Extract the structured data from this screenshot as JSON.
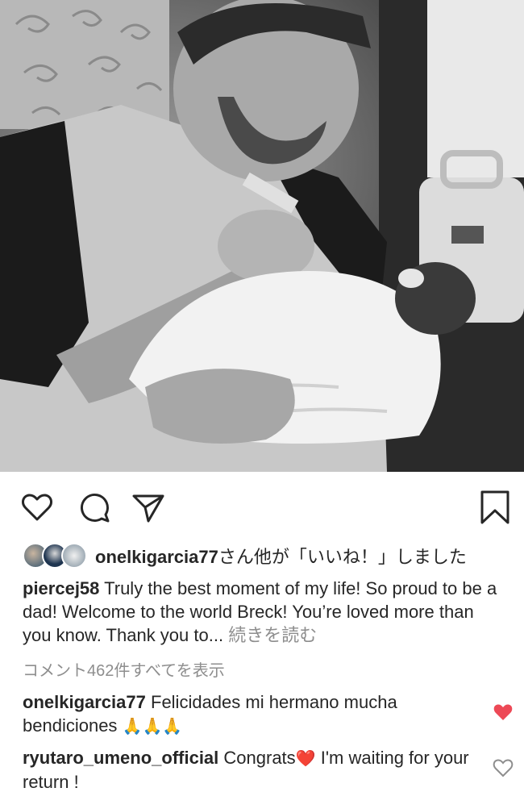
{
  "photo": {
    "alt": ""
  },
  "actions": {
    "like_icon": "heart-outline-icon",
    "comment_icon": "comment-bubble-icon",
    "share_icon": "paper-plane-icon",
    "save_icon": "bookmark-icon"
  },
  "likes": {
    "user": "onelkigarcia77",
    "suffix": "さん他が「いいね！」しました"
  },
  "caption": {
    "user": "piercej58",
    "text": "Truly the best moment of my life! So proud to be a dad! Welcome to the world Breck! You’re loved more than you know. Thank you to...",
    "more": "続きを読む"
  },
  "view_all_comments": "コメント462件すべてを表示",
  "comments": [
    {
      "user": "onelkigarcia77",
      "text": "Felicidades mi hermano mucha bendiciones",
      "emoji": "🙏🙏🙏",
      "liked": true
    },
    {
      "user": "ryutaro_umeno_official",
      "text_before": "Congrats",
      "emoji": "❤️",
      "text_after": " I'm waiting for your return !",
      "liked": false
    }
  ],
  "colors": {
    "text": "#262626",
    "muted": "#8e8e8e",
    "liked_heart": "#ed4956"
  }
}
